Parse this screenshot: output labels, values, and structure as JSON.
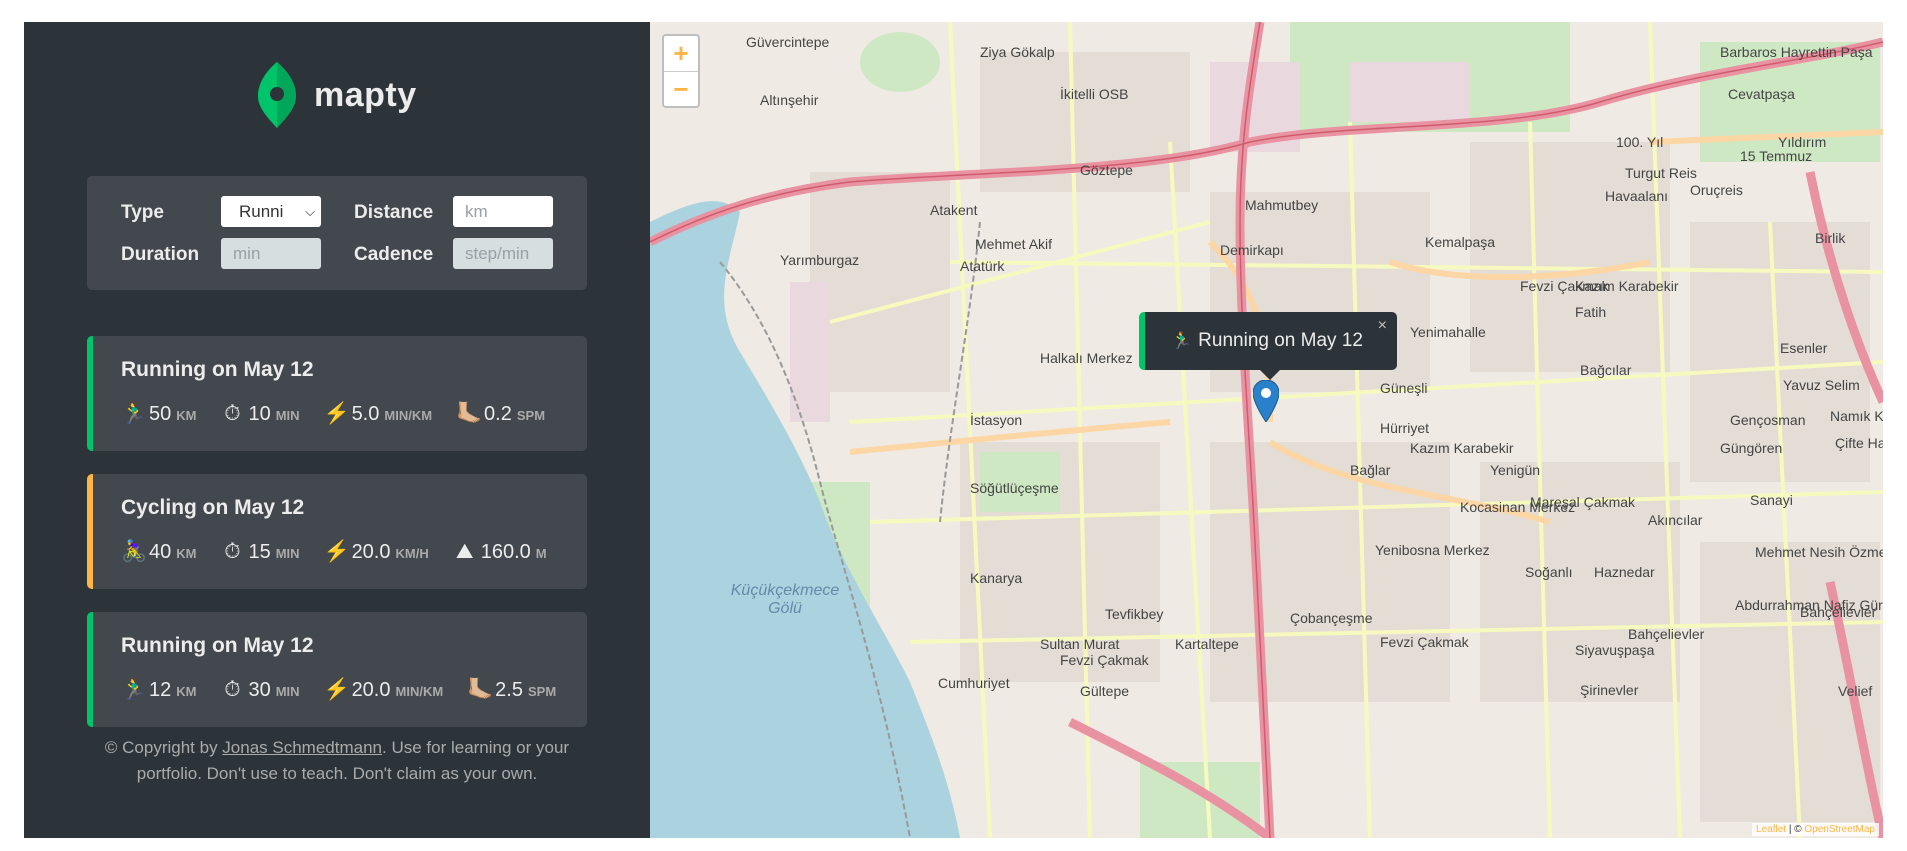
{
  "logo": {
    "text": "mapty"
  },
  "form": {
    "type_label": "Type",
    "type_value": "Runni",
    "distance_label": "Distance",
    "distance_placeholder": "km",
    "duration_label": "Duration",
    "duration_placeholder": "min",
    "cadence_label": "Cadence",
    "cadence_placeholder": "step/min"
  },
  "workouts": [
    {
      "title": "Running on May 12",
      "type": "running",
      "details": [
        {
          "icon": "🏃‍♂️",
          "value": "50",
          "unit": "km"
        },
        {
          "icon": "⏱",
          "value": "10",
          "unit": "min"
        },
        {
          "icon": "⚡️",
          "value": "5.0",
          "unit": "min/km"
        },
        {
          "icon": "🦶🏼",
          "value": "0.2",
          "unit": "spm"
        }
      ]
    },
    {
      "title": "Cycling on May 12",
      "type": "cycling",
      "details": [
        {
          "icon": "🚴‍♀️",
          "value": "40",
          "unit": "km"
        },
        {
          "icon": "⏱",
          "value": "15",
          "unit": "min"
        },
        {
          "icon": "⚡️",
          "value": "20.0",
          "unit": "km/h"
        },
        {
          "icon": "⛰",
          "value": "160.0",
          "unit": "m"
        }
      ]
    },
    {
      "title": "Running on May 12",
      "type": "running",
      "details": [
        {
          "icon": "🏃‍♂️",
          "value": "12",
          "unit": "km"
        },
        {
          "icon": "⏱",
          "value": "30",
          "unit": "min"
        },
        {
          "icon": "⚡️",
          "value": "20.0",
          "unit": "min/km"
        },
        {
          "icon": "🦶🏼",
          "value": "2.5",
          "unit": "spm"
        }
      ]
    }
  ],
  "copyright": {
    "prefix": "© Copyright by ",
    "author": "Jonas Schmedtmann",
    "suffix": ". Use for learning or your portfolio. Don't use to teach. Don't claim as your own."
  },
  "map": {
    "zoom_in": "+",
    "zoom_out": "−",
    "popup_icon": "🏃‍♂️",
    "popup_text": "Running on May 12",
    "popup_close": "×",
    "attribution_leaflet": "Leaflet",
    "attribution_sep": " | © ",
    "attribution_osm": "OpenStreetMap",
    "place_labels": [
      "Güvercintepe",
      "Ziya Gökalp",
      "Barbaros Hayrettin Paşa",
      "Altınşehir",
      "İkitelli OSB",
      "Cevatpaşa",
      "100. Yıl",
      "Yıldırım",
      "Turgut Reis",
      "15 Temmuz",
      "Göztepe",
      "Mahmutbey",
      "Oruçreis",
      "Havaalanı",
      "Atakent",
      "Mehmet Akif",
      "Birlik",
      "Yarımburgaz",
      "Atatürk",
      "Demirkapı",
      "Kemalpaşa",
      "Fevzi Çakmak",
      "Kazım Karabekir",
      "Fatih",
      "Yenimahalle",
      "15 Temmuz",
      "Esenler",
      "Bağcılar",
      "Halkalı Merkez",
      "Güneşli",
      "Hürriyet",
      "Yavuz Selim",
      "İstasyon",
      "Gençosman",
      "Namık Kemal",
      "Kazım Karabekir",
      "Güngören",
      "Çifte Havuzlar",
      "Bağlar",
      "Yenigün",
      "Söğütlüçeşme",
      "Mareşal Çakmak",
      "Sanayi",
      "Akıncılar",
      "Kocasinan Merkez",
      "Yenibosna Merkez",
      "Soğanlı",
      "Haznedar",
      "Mehmet Nesih Özmen",
      "Kanarya",
      "Tevfikbey",
      "Bahçelievler",
      "Abdurrahman Nafiz Gürman",
      "Fevzi Çakmak",
      "Çobançeşme",
      "Sultan Murat",
      "Kartaltepe",
      "Fevzi Çakmak",
      "Siyavuşpaşa",
      "Bahçelievler",
      "Cumhuriyet",
      "Şirinevler",
      "Gültepe",
      "Velief"
    ],
    "water_labels": [
      "Küçükçekmece Gölü"
    ]
  },
  "colors": {
    "running": "#00c46a",
    "cycling": "#ffb545",
    "sidebar_bg": "#2d3439",
    "card_bg": "#42484d",
    "marker": "#2a81cb"
  }
}
